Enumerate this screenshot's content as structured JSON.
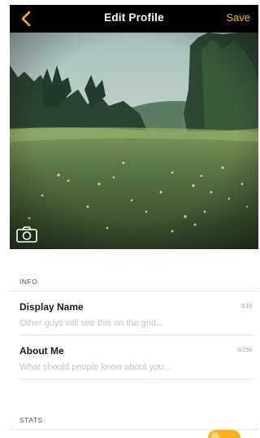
{
  "navbar": {
    "title": "Edit Profile",
    "save_label": "Save",
    "back_icon": "chevron-left-icon",
    "accent_color": "#f6b21e",
    "background_color": "#000000"
  },
  "photo": {
    "camera_icon": "camera-icon"
  },
  "info_section": {
    "header": "INFO",
    "fields": [
      {
        "label": "Display Name",
        "count": "0/15",
        "placeholder": "Other guys will see this on the grid..."
      },
      {
        "label": "About Me",
        "count": "0/250",
        "placeholder": "What should people know about you..."
      }
    ]
  },
  "stats_section": {
    "header": "STATS"
  }
}
